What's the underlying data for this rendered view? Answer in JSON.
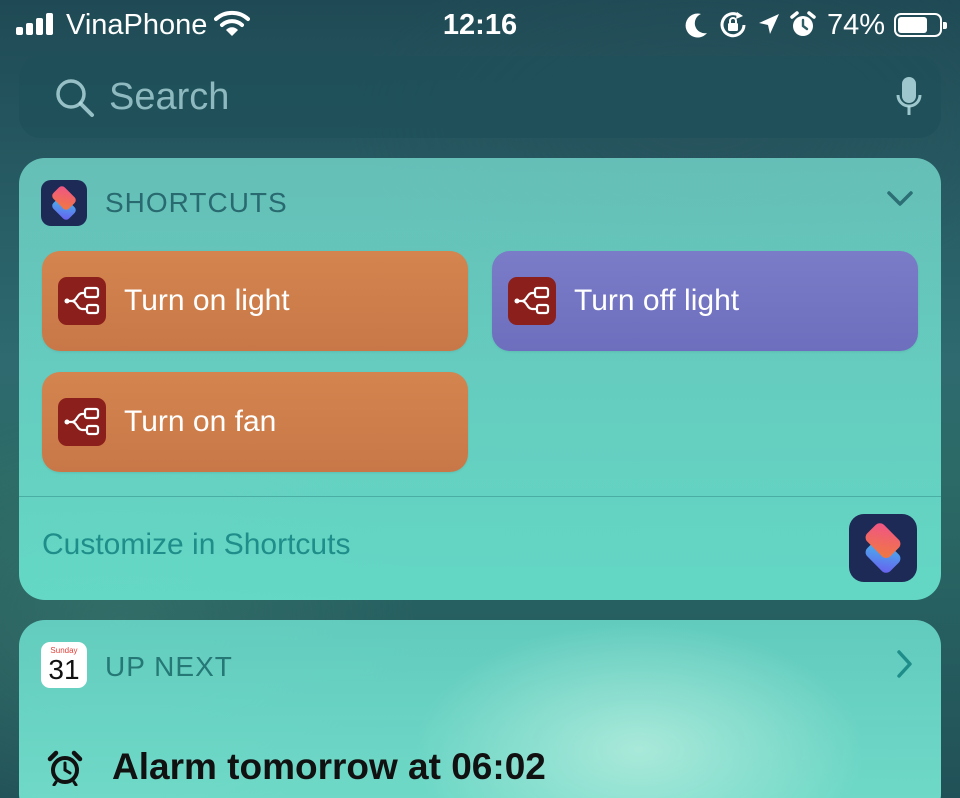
{
  "status_bar": {
    "carrier": "VinaPhone",
    "time": "12:16",
    "battery_percent": "74%",
    "battery_level": 0.74,
    "icons": [
      "signal-icon",
      "wifi-icon",
      "moon-icon",
      "rotation-lock-icon",
      "location-icon",
      "alarm-icon",
      "battery-icon"
    ]
  },
  "search": {
    "placeholder": "Search"
  },
  "shortcuts_widget": {
    "title": "SHORTCUTS",
    "buttons": [
      {
        "label": "Turn on light",
        "color": "#d4844e"
      },
      {
        "label": "Turn off light",
        "color": "#7a7cc8"
      },
      {
        "label": "Turn on fan",
        "color": "#d4844e"
      }
    ],
    "customize_label": "Customize in Shortcuts"
  },
  "up_next_widget": {
    "calendar_day": "Sunday",
    "calendar_date": "31",
    "title": "UP NEXT",
    "alarm_text": "Alarm tomorrow at 06:02"
  }
}
